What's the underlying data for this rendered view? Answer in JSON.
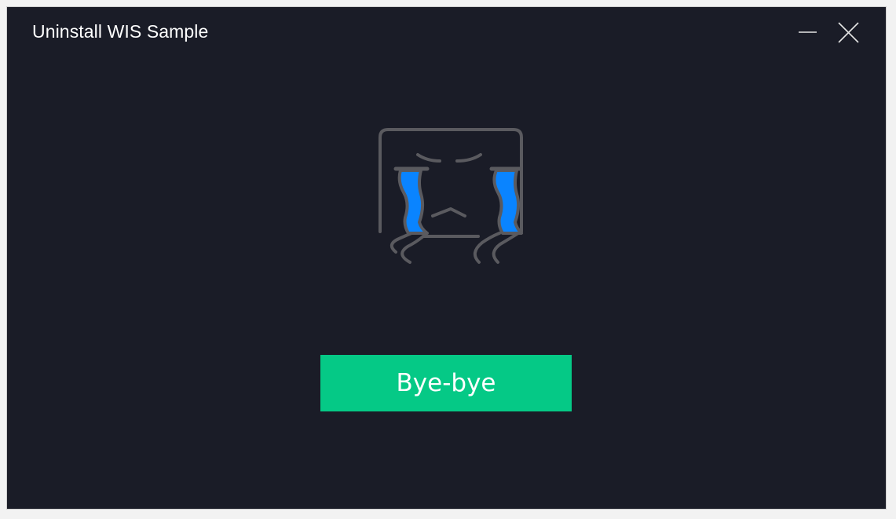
{
  "window": {
    "title": "Uninstall WIS Sample",
    "controls": {
      "minimize_icon": "minimize-icon",
      "close_icon": "close-icon"
    }
  },
  "illustration": {
    "icon": "crying-face-icon",
    "tear_color": "#0a84ff",
    "line_color": "#5a5a5f"
  },
  "actions": {
    "bye_label": "Bye-bye",
    "bye_color": "#05c986"
  },
  "theme": {
    "background": "#1a1c27"
  }
}
